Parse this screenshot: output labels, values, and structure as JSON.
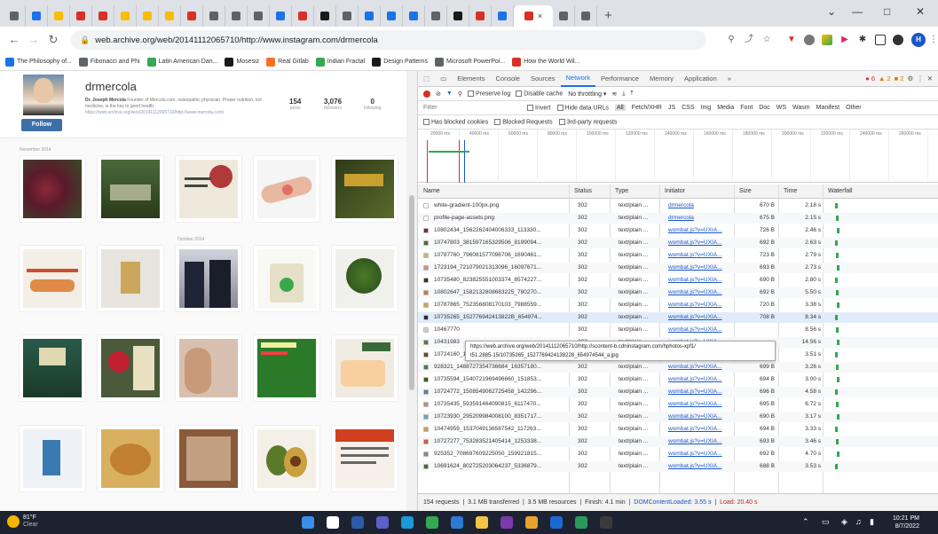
{
  "browser": {
    "tabs": [
      {
        "letter": "",
        "color": "#5f6368"
      },
      {
        "letter": "",
        "color": "#1a73e8"
      },
      {
        "letter": "",
        "color": "#fbbc04"
      },
      {
        "letter": "",
        "color": "#d93025"
      },
      {
        "letter": "",
        "color": "#d93025"
      },
      {
        "letter": "",
        "color": "#fbbc04"
      },
      {
        "letter": "",
        "color": "#fbbc04"
      },
      {
        "letter": "",
        "color": "#fbbc04"
      },
      {
        "letter": "",
        "color": "#d93025"
      },
      {
        "letter": "",
        "color": "#5f6368"
      },
      {
        "letter": "",
        "color": "#5f6368"
      },
      {
        "letter": "",
        "color": "#5f6368"
      },
      {
        "letter": "",
        "color": "#1a73e8"
      },
      {
        "letter": "",
        "color": "#d93025"
      },
      {
        "letter": "",
        "color": "#1a1a1a"
      },
      {
        "letter": "",
        "color": "#5f6368"
      },
      {
        "letter": "",
        "color": "#1a73e8"
      },
      {
        "letter": "",
        "color": "#1a73e8"
      },
      {
        "letter": "",
        "color": "#1a73e8"
      },
      {
        "letter": "",
        "color": "#5f6368"
      },
      {
        "letter": "",
        "color": "#1a1a1a"
      },
      {
        "letter": "",
        "color": "#d93025"
      },
      {
        "letter": "",
        "color": "#1a73e8"
      },
      {
        "letter": "",
        "color": "#d93025"
      },
      {
        "letter": "",
        "color": "#5f6368"
      },
      {
        "letter": "",
        "color": "#5f6368"
      }
    ],
    "active_tab_close": "×",
    "new_tab": "+",
    "url": "web.archive.org/web/20141112065710/http://www.instagram.com/drmercola",
    "profile_initial": "H",
    "bookmarks": [
      {
        "label": "The Philosophy of...",
        "color": "#1a73e8"
      },
      {
        "label": "Fibonacci and Phi",
        "color": "#5f6368"
      },
      {
        "label": "Latin American Dan...",
        "color": "#34a853"
      },
      {
        "label": "Mosesiz",
        "color": "#1a1a1a"
      },
      {
        "label": "Real Gitlab",
        "color": "#fc6d26"
      },
      {
        "label": "Indian Fractal",
        "color": "#34a853"
      },
      {
        "label": "Design Patterns",
        "color": "#1a1a1a"
      },
      {
        "label": "Microsoft PowerPoi...",
        "color": "#5f6368"
      },
      {
        "label": "How the World Wil...",
        "color": "#d93025"
      }
    ]
  },
  "profile": {
    "username": "drmercola",
    "bio_name": "Dr. Joseph Mercola",
    "bio_text": "Founder of Mercola.com, osteopathic physician. Proper nutrition, not medicine, is the key to good health.",
    "bio_link": "https://web.archive.org/web/20141112065710/http://www.mercola.com/",
    "follow_label": "Follow",
    "posts": "154",
    "posts_label": "posts",
    "followers": "3,076",
    "followers_label": "followers",
    "following": "0",
    "following_label": "following",
    "date_nov": "November 2014",
    "date_oct": "October 2014"
  },
  "devtools": {
    "tabs": [
      "Elements",
      "Console",
      "Sources",
      "Network",
      "Performance",
      "Memory",
      "Application",
      "»"
    ],
    "active_tab": "Network",
    "badges": {
      "errors": "6",
      "warnings": "2",
      "info": "2"
    },
    "preserve_log": "Preserve log",
    "disable_cache": "Disable cache",
    "throttling": "No throttling",
    "filter_placeholder": "Filter",
    "invert": "Invert",
    "hide_data_urls": "Hide data URLs",
    "types": [
      "All",
      "Fetch/XHR",
      "JS",
      "CSS",
      "Img",
      "Media",
      "Font",
      "Doc",
      "WS",
      "Wasm",
      "Manifest",
      "Other"
    ],
    "has_blocked_cookies": "Has blocked cookies",
    "blocked_requests": "Blocked Requests",
    "third_party": "3rd-party requests",
    "timeline_ticks": [
      "20000 ms",
      "40000 ms",
      "60000 ms",
      "80000 ms",
      "100000 ms",
      "120000 ms",
      "140000 ms",
      "160000 ms",
      "180000 ms",
      "200000 ms",
      "220000 ms",
      "240000 ms",
      "260000 ms"
    ],
    "columns": [
      "Name",
      "Status",
      "Type",
      "Initiator",
      "Size",
      "Time",
      "Waterfall"
    ],
    "rows": [
      {
        "name": "white-gradient-100px.png",
        "status": "302",
        "type": "text/plain ...",
        "initiator": "drmercola",
        "size": "670 B",
        "time": "2.18 s",
        "icon": "#ffffff"
      },
      {
        "name": "profile-page-assets.png",
        "status": "302",
        "type": "text/plain ...",
        "initiator": "drmercola",
        "size": "675 B",
        "time": "2.15 s",
        "icon": "#ffffff"
      },
      {
        "name": "10802434_1562262404006333_113330...",
        "status": "302",
        "type": "text/plain ...",
        "initiator": "wombat.js?v=UXIA...",
        "size": "726 B",
        "time": "2.46 s",
        "icon": "#7a2e3a"
      },
      {
        "name": "10747803_381597165329506_8199094...",
        "status": "302",
        "type": "text/plain ...",
        "initiator": "wombat.js?v=UXIA...",
        "size": "692 B",
        "time": "2.63 s",
        "icon": "#4a6a3a"
      },
      {
        "name": "10787760_796081577096706_1690461...",
        "status": "302",
        "type": "text/plain ...",
        "initiator": "wombat.js?v=UXIA...",
        "size": "723 B",
        "time": "2.79 s",
        "icon": "#c9b27a"
      },
      {
        "name": "1723194_721079021313096_16097671...",
        "status": "302",
        "type": "text/plain ...",
        "initiator": "wombat.js?v=UXIA...",
        "size": "693 B",
        "time": "2.73 s",
        "icon": "#d98a8a"
      },
      {
        "name": "10735480_823825551003374_8574227...",
        "status": "302",
        "type": "text/plain ...",
        "initiator": "wombat.js?v=UXIA...",
        "size": "690 B",
        "time": "2.80 s",
        "icon": "#2f3a1a"
      },
      {
        "name": "10802647_1582132808683225_780270...",
        "status": "302",
        "type": "text/plain ...",
        "initiator": "wombat.js?v=UXIA...",
        "size": "692 B",
        "time": "5.50 s",
        "icon": "#c97a4a"
      },
      {
        "name": "10787865_752356808170103_7988559...",
        "status": "302",
        "type": "text/plain ...",
        "initiator": "wombat.js?v=UXIA...",
        "size": "720 B",
        "time": "3.38 s",
        "icon": "#caa75a"
      },
      {
        "name": "10735265_152776942413822B_654974...",
        "status": "302",
        "type": "text/plain ...",
        "initiator": "wombat.js?v=UXIA...",
        "size": "708 B",
        "time": "8.34 s",
        "icon": "#2a2a3a"
      },
      {
        "name": "10467770",
        "status": "302",
        "type": "text/plain ...",
        "initiator": "wombat.js?v=UXIA...",
        "size": "",
        "time": "8.56 s",
        "icon": "#d0d0d0"
      },
      {
        "name": "10431983",
        "status": "302",
        "type": "text/plain ...",
        "initiator": "wombat.js?v=UXIA...",
        "size": "",
        "time": "14.56 s",
        "icon": "#5a7a3a"
      },
      {
        "name": "10724160_1554697944761550_314696...",
        "status": "302",
        "type": "text/plain ...",
        "initiator": "wombat.js?v=UXIA...",
        "size": "695 B",
        "time": "3.51 s",
        "icon": "#6a4a2a"
      },
      {
        "name": "928321_1488727354736684_16357180...",
        "status": "302",
        "type": "text/plain ...",
        "initiator": "wombat.js?v=UXIA...",
        "size": "699 B",
        "time": "3.26 s",
        "icon": "#4a7a4a"
      },
      {
        "name": "10735594_1540721969496660_151853...",
        "status": "302",
        "type": "text/plain ...",
        "initiator": "wombat.js?v=UXIA...",
        "size": "694 B",
        "time": "3.00 s",
        "icon": "#3a5a2a"
      },
      {
        "name": "10724772_1508549062725458_142296...",
        "status": "302",
        "type": "text/plain ...",
        "initiator": "wombat.js?v=UXIA...",
        "size": "696 B",
        "time": "4.58 s",
        "icon": "#6a7a9a"
      },
      {
        "name": "10735435_593591464090815_6117470...",
        "status": "302",
        "type": "text/plain ...",
        "initiator": "wombat.js?v=UXIA...",
        "size": "695 B",
        "time": "6.72 s",
        "icon": "#c98a6a"
      },
      {
        "name": "10723930_295209984008100_8351717...",
        "status": "302",
        "type": "text/plain ...",
        "initiator": "wombat.js?v=UXIA...",
        "size": "690 B",
        "time": "3.17 s",
        "icon": "#7a9aba"
      },
      {
        "name": "10474959_1537049136587542_117263...",
        "status": "302",
        "type": "text/plain ...",
        "initiator": "wombat.js?v=UXIA...",
        "size": "694 B",
        "time": "3.33 s",
        "icon": "#c9a05a"
      },
      {
        "name": "10727277_753283521405414_1253338...",
        "status": "302",
        "type": "text/plain ...",
        "initiator": "wombat.js?v=UXIA...",
        "size": "693 B",
        "time": "3.46 s",
        "icon": "#d05a3a"
      },
      {
        "name": "925352_708697609225050_159921815...",
        "status": "302",
        "type": "text/plain ...",
        "initiator": "wombat.js?v=UXIA...",
        "size": "692 B",
        "time": "4.70 s",
        "icon": "#8a8a8a"
      },
      {
        "name": "10691624_802725203064237_5336879...",
        "status": "302",
        "type": "text/plain ...",
        "initiator": "wombat.js?v=UXIA...",
        "size": "688 B",
        "time": "3.53 s",
        "icon": "#4a6a2a"
      }
    ],
    "tooltip_line1": "https://web.archive.org/web/20141112065710/http://scontent-b.cdninstagram.com/hphotos-xpf1/",
    "tooltip_line2": "t51.2885-15/10735265_1527769424138228_654974544_a.jpg",
    "status_requests": "154 requests",
    "status_transferred": "3.1 MB transferred",
    "status_resources": "3.5 MB resources",
    "status_finish": "Finish: 4.1 min",
    "status_dcl": "DOMContentLoaded: 3.55 s",
    "status_load": "Load: 20.40 s"
  },
  "taskbar": {
    "temp": "81°F",
    "weather": "Clear",
    "time": "10:21 PM",
    "date": "8/7/2022",
    "apps": [
      {
        "name": "start",
        "color": "#3a8fe8"
      },
      {
        "name": "search",
        "color": "#ffffff"
      },
      {
        "name": "task-view",
        "color": "#2a5aa8"
      },
      {
        "name": "teams",
        "color": "#5b5fc7"
      },
      {
        "name": "edge",
        "color": "#1a9ad6"
      },
      {
        "name": "chrome",
        "color": "#34a853"
      },
      {
        "name": "store",
        "color": "#2a7ad6"
      },
      {
        "name": "explorer",
        "color": "#f4c542"
      },
      {
        "name": "onenote",
        "color": "#7a3aa8"
      },
      {
        "name": "chrome-2",
        "color": "#e8a32a"
      },
      {
        "name": "mail",
        "color": "#1a6ad6"
      },
      {
        "name": "photos",
        "color": "#2a9a5a"
      },
      {
        "name": "terminal",
        "color": "#3a3a3a"
      }
    ]
  }
}
